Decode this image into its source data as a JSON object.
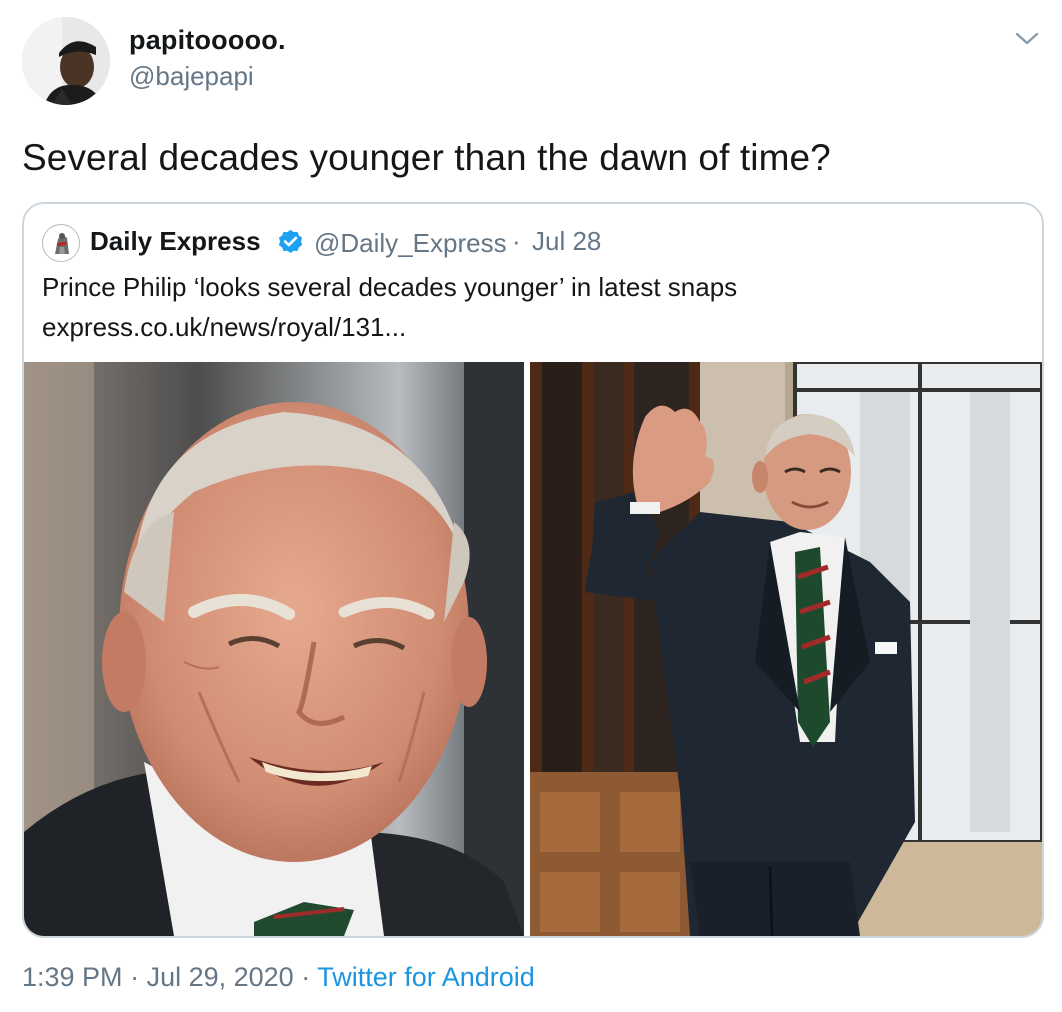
{
  "author": {
    "display_name": "papitooooo.",
    "handle": "@bajepapi"
  },
  "tweet": {
    "text": "Several decades younger than the dawn of time?"
  },
  "quoted": {
    "display_name": "Daily Express",
    "verified": true,
    "handle": "@Daily_Express",
    "separator": "·",
    "date": "Jul 28",
    "text": "Prince Philip ‘looks several decades younger’ in latest snaps",
    "link": "express.co.uk/news/royal/131..."
  },
  "meta": {
    "time": "1:39 PM",
    "separator_1": " · ",
    "date": "Jul 29, 2020",
    "separator_2": " · ",
    "source": "Twitter for Android"
  },
  "icons": {
    "menu": "chevron-down-icon",
    "verified": "verified-badge-icon"
  },
  "colors": {
    "text_primary": "#14171a",
    "text_secondary": "#657786",
    "link": "#1b95e0",
    "verified": "#1da1f2",
    "border": "#ccd6dd"
  }
}
